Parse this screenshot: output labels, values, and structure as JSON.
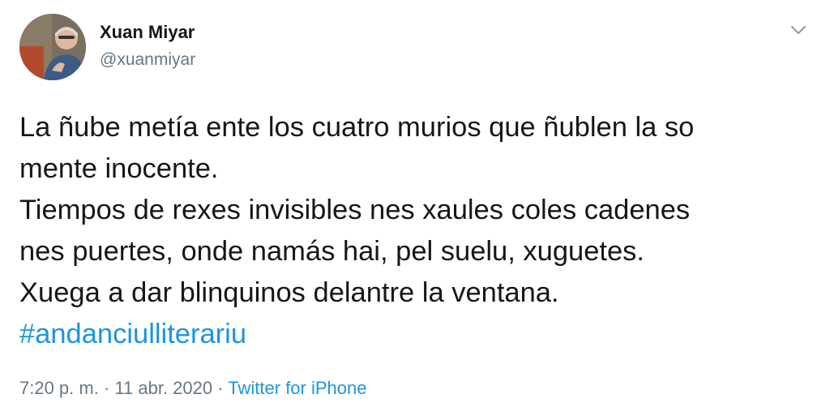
{
  "author": {
    "name": "Xuan Miyar",
    "handle": "@xuanmiyar"
  },
  "tweet": {
    "lines": [
      "La ñube metía ente los cuatro murios que ñublen la so",
      "mente inocente.",
      "Tiempos de rexes invisibles nes xaules coles cadenes",
      "nes puertes, onde namás hai, pel suelu, xuguetes.",
      "Xuega a dar blinquinos delantre la ventana."
    ],
    "hashtag": "#andanciulliterariu"
  },
  "meta": {
    "time": "7:20 p. m.",
    "separator1": "·",
    "date": "11 abr. 2020",
    "separator2": "·",
    "source": "Twitter for iPhone"
  },
  "colors": {
    "text": "#14171a",
    "secondary": "#657786",
    "link": "#1b95e0"
  },
  "icons": {
    "caret": "chevron-down-icon"
  }
}
